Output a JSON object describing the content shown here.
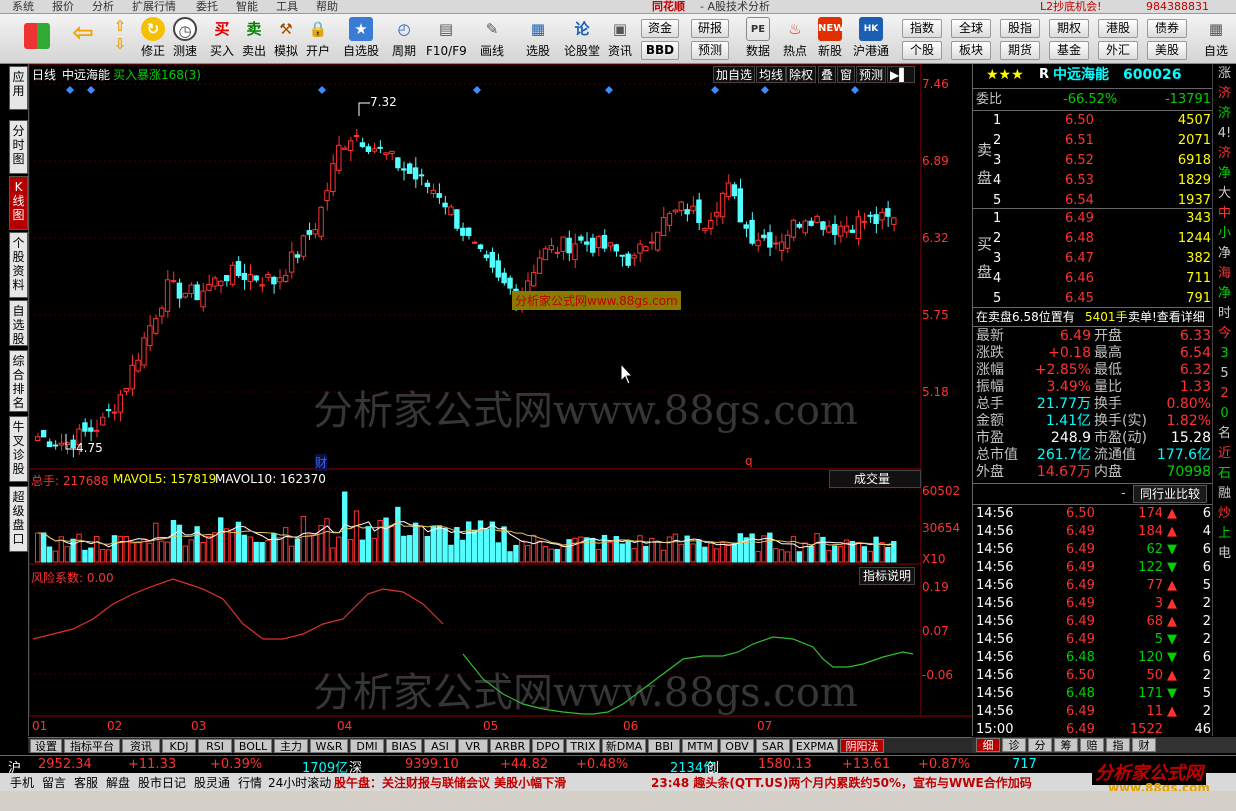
{
  "menubar": {
    "items": [
      "系统",
      "报价",
      "分析",
      "扩展行情",
      "委托",
      "智能",
      "工具",
      "帮助"
    ],
    "title": "同花顺",
    "subtitle": "- A股技术分析",
    "ad": "L2抄底机会!",
    "account": "984388831"
  },
  "toolbar": {
    "buttons": [
      "修正",
      "测速",
      "买入",
      "卖出",
      "模拟",
      "开户",
      "自选股",
      "周期",
      "F10/F9",
      "画线",
      "选股",
      "论股堂",
      "资讯",
      "数据",
      "热点",
      "新股",
      "沪港通",
      "自选"
    ],
    "quick": [
      "资金",
      "研报",
      "BBD",
      "预测",
      "指数",
      "全球",
      "股指",
      "期权",
      "港股",
      "债券",
      "个股",
      "板块",
      "期货",
      "基金",
      "外汇",
      "美股"
    ]
  },
  "lefttabs": [
    "应用",
    "分时图",
    "K线图",
    "个股资料",
    "自选股",
    "综合排名",
    "牛叉诊股",
    "超级盘口"
  ],
  "kline": {
    "period": "日线",
    "stock_name": "中远海能",
    "signal": "买入暴涨168(3)",
    "buttons": [
      "加自选",
      "均线",
      "除权",
      "叠",
      "窗",
      "预测"
    ],
    "price_axis": [
      "7.46",
      "6.89",
      "6.32",
      "5.75",
      "5.18"
    ],
    "high_label": "7.32",
    "low_label": "4.75",
    "mark_cai": "财",
    "mark_q": "q",
    "ad_box": "分析家公式网www.88gs.com"
  },
  "volume": {
    "label_total": "总手: 217688",
    "label_ma5": "MAVOL5: 157819",
    "label_ma10": "MAVOL10: 162370",
    "selector": "成交量",
    "axis": [
      "60502",
      "30654",
      "X10"
    ]
  },
  "risk": {
    "label": "风险系数: 0.00",
    "button": "指标说明",
    "axis": [
      "0.19",
      "0.07",
      "-0.06"
    ]
  },
  "xaxis": [
    "01",
    "02",
    "03",
    "04",
    "05",
    "06",
    "07"
  ],
  "watermark": "分析家公式网www.88gs.com",
  "quote": {
    "stars": "★★★",
    "market": "R",
    "name": "中远海能",
    "code": "600026",
    "weibi_label": "委比",
    "weibi": "-66.52%",
    "weicha": "-13791",
    "sell_label": "卖盘",
    "buy_label": "买盘",
    "sell": [
      {
        "n": "5",
        "p": "6.54",
        "v": "1937"
      },
      {
        "n": "4",
        "p": "6.53",
        "v": "1829"
      },
      {
        "n": "3",
        "p": "6.52",
        "v": "6918"
      },
      {
        "n": "2",
        "p": "6.51",
        "v": "2071"
      },
      {
        "n": "1",
        "p": "6.50",
        "v": "4507"
      }
    ],
    "buy": [
      {
        "n": "1",
        "p": "6.49",
        "v": "343"
      },
      {
        "n": "2",
        "p": "6.48",
        "v": "1244"
      },
      {
        "n": "3",
        "p": "6.47",
        "v": "382"
      },
      {
        "n": "4",
        "p": "6.46",
        "v": "711"
      },
      {
        "n": "5",
        "p": "6.45",
        "v": "791"
      }
    ],
    "notice_a": "在卖盘6.58位置有",
    "notice_b": "5401手",
    "notice_c": "卖单!查看详细",
    "stats": [
      [
        "最新",
        "6.49",
        "开盘",
        "6.33"
      ],
      [
        "涨跌",
        "+0.18",
        "最高",
        "6.54"
      ],
      [
        "涨幅",
        "+2.85%",
        "最低",
        "6.32"
      ],
      [
        "振幅",
        "3.49%",
        "量比",
        "1.33"
      ],
      [
        "总手",
        "21.77万",
        "换手",
        "0.80%"
      ],
      [
        "金额",
        "1.41亿",
        "换手(实)",
        "1.82%"
      ],
      [
        "市盈",
        "248.9",
        "市盈(动)",
        "15.28"
      ],
      [
        "总市值",
        "261.7亿",
        "流通值",
        "177.6亿"
      ],
      [
        "外盘",
        "14.67万",
        "内盘",
        "70998"
      ]
    ],
    "compare_btn": "同行业比较",
    "ticks": [
      [
        "14:56",
        "6.50",
        "174",
        "6"
      ],
      [
        "14:56",
        "6.49",
        "184",
        "4"
      ],
      [
        "14:56",
        "6.49",
        "62",
        "6"
      ],
      [
        "14:56",
        "6.49",
        "122",
        "6"
      ],
      [
        "14:56",
        "6.49",
        "77",
        "5"
      ],
      [
        "14:56",
        "6.49",
        "3",
        "2"
      ],
      [
        "14:56",
        "6.49",
        "68",
        "2"
      ],
      [
        "14:56",
        "6.49",
        "5",
        "2"
      ],
      [
        "14:56",
        "6.48",
        "120",
        "6"
      ],
      [
        "14:56",
        "6.50",
        "50",
        "2"
      ],
      [
        "14:56",
        "6.48",
        "171",
        "5"
      ],
      [
        "14:56",
        "6.49",
        "11",
        "2"
      ],
      [
        "15:00",
        "6.49",
        "1522",
        "46"
      ]
    ]
  },
  "farright": [
    "涨",
    "济",
    "济",
    "4!",
    "济",
    "净",
    "大",
    "中",
    "小",
    "净",
    "海",
    "净",
    "时",
    "今",
    "3",
    "5",
    "2",
    "0",
    "名",
    "近",
    "石",
    "融",
    "炒",
    "上",
    "电"
  ],
  "bottomtabs": [
    "设置",
    "指标平台",
    "资讯",
    "KDJ",
    "RSI",
    "BOLL",
    "主力",
    "W&R",
    "DMI",
    "BIAS",
    "ASI",
    "VR",
    "ARBR",
    "DPO",
    "TRIX",
    "新DMA",
    "BBI",
    "MTM",
    "OBV",
    "SAR",
    "EXPMA",
    "阴阳法"
  ],
  "righttabs": [
    "细",
    "诊",
    "分",
    "筹",
    "赔",
    "指",
    "财"
  ],
  "status": {
    "sh": "沪",
    "sh_idx": "2952.34",
    "sh_chg": "+11.33",
    "sh_pct": "+0.39%",
    "sh_amt": "1709亿",
    "sz": "深",
    "sz_idx": "9399.10",
    "sz_chg": "+44.82",
    "sz_pct": "+0.48%",
    "sz_amt": "2134亿",
    "cy": "创",
    "cy_idx": "1580.13",
    "cy_chg": "+13.61",
    "cy_pct": "+0.87%",
    "cy_amt": "717"
  },
  "footer": {
    "items": [
      "手机",
      "留言",
      "客服",
      "解盘",
      "股市日记",
      "股灵通",
      "行情",
      "24小时滚动"
    ],
    "news1": "股午盘：关注财报与联储会议 美股小幅下滑",
    "news2": "23:48 趣头条(QTT.US)两个月内累跌约50%，宣布与WWE合作加码",
    "logo": "分析家公式网",
    "logo_url": "www.88gs.com"
  }
}
